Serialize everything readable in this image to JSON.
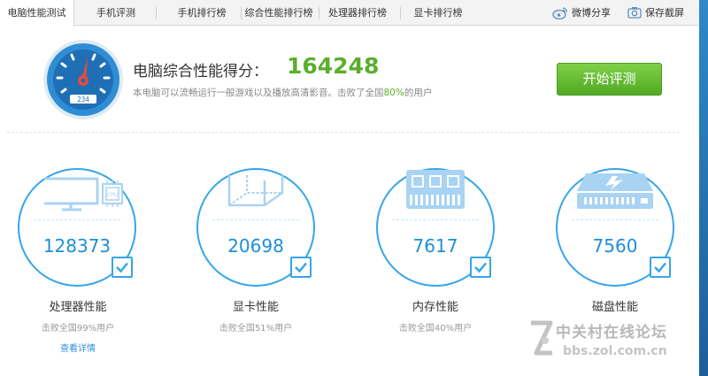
{
  "tabs": [
    {
      "label": "电脑性能测试",
      "active": true
    },
    {
      "label": "手机评测",
      "active": false
    },
    {
      "label": "手机排行榜",
      "active": false
    },
    {
      "label": "综合性能排行榜",
      "active": false
    },
    {
      "label": "处理器排行榜",
      "active": false
    },
    {
      "label": "显卡排行榜",
      "active": false
    }
  ],
  "toolbar": {
    "share_label": "微博分享",
    "screenshot_label": "保存截屏"
  },
  "summary": {
    "title": "电脑综合性能得分：",
    "score": "164248",
    "desc_prefix": "本电脑可以流畅运行一般游戏以及播放高清影音。击败了全国",
    "desc_pct": "80%",
    "desc_suffix": "的用户",
    "gauge_readout": "234",
    "start_button": "开始评测"
  },
  "cards": [
    {
      "name": "cpu",
      "value": "128373",
      "title": "处理器性能",
      "sub": "击败全国99%用户",
      "chip_label": "CPU",
      "checked": true
    },
    {
      "name": "gpu",
      "value": "20698",
      "title": "显卡性能",
      "sub": "击败全国51%用户",
      "checked": true
    },
    {
      "name": "memory",
      "value": "7617",
      "title": "内存性能",
      "sub": "击败全国40%用户",
      "checked": true
    },
    {
      "name": "disk",
      "value": "7560",
      "title": "磁盘性能",
      "sub": "",
      "checked": true
    }
  ],
  "detail_link": "查看详情",
  "watermark": {
    "text": "中关村在线论坛",
    "url": "bbs.zol.com.cn"
  },
  "colors": {
    "accent_blue": "#36a5ea",
    "score_green": "#5cae2d",
    "button_green": "#52a923"
  }
}
